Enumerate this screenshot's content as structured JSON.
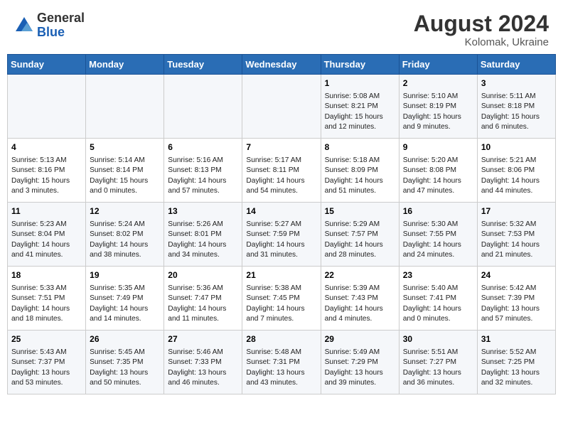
{
  "header": {
    "logo_general": "General",
    "logo_blue": "Blue",
    "month_year": "August 2024",
    "location": "Kolomak, Ukraine"
  },
  "days_of_week": [
    "Sunday",
    "Monday",
    "Tuesday",
    "Wednesday",
    "Thursday",
    "Friday",
    "Saturday"
  ],
  "weeks": [
    [
      {
        "day": "",
        "info": ""
      },
      {
        "day": "",
        "info": ""
      },
      {
        "day": "",
        "info": ""
      },
      {
        "day": "",
        "info": ""
      },
      {
        "day": "1",
        "info": "Sunrise: 5:08 AM\nSunset: 8:21 PM\nDaylight: 15 hours\nand 12 minutes."
      },
      {
        "day": "2",
        "info": "Sunrise: 5:10 AM\nSunset: 8:19 PM\nDaylight: 15 hours\nand 9 minutes."
      },
      {
        "day": "3",
        "info": "Sunrise: 5:11 AM\nSunset: 8:18 PM\nDaylight: 15 hours\nand 6 minutes."
      }
    ],
    [
      {
        "day": "4",
        "info": "Sunrise: 5:13 AM\nSunset: 8:16 PM\nDaylight: 15 hours\nand 3 minutes."
      },
      {
        "day": "5",
        "info": "Sunrise: 5:14 AM\nSunset: 8:14 PM\nDaylight: 15 hours\nand 0 minutes."
      },
      {
        "day": "6",
        "info": "Sunrise: 5:16 AM\nSunset: 8:13 PM\nDaylight: 14 hours\nand 57 minutes."
      },
      {
        "day": "7",
        "info": "Sunrise: 5:17 AM\nSunset: 8:11 PM\nDaylight: 14 hours\nand 54 minutes."
      },
      {
        "day": "8",
        "info": "Sunrise: 5:18 AM\nSunset: 8:09 PM\nDaylight: 14 hours\nand 51 minutes."
      },
      {
        "day": "9",
        "info": "Sunrise: 5:20 AM\nSunset: 8:08 PM\nDaylight: 14 hours\nand 47 minutes."
      },
      {
        "day": "10",
        "info": "Sunrise: 5:21 AM\nSunset: 8:06 PM\nDaylight: 14 hours\nand 44 minutes."
      }
    ],
    [
      {
        "day": "11",
        "info": "Sunrise: 5:23 AM\nSunset: 8:04 PM\nDaylight: 14 hours\nand 41 minutes."
      },
      {
        "day": "12",
        "info": "Sunrise: 5:24 AM\nSunset: 8:02 PM\nDaylight: 14 hours\nand 38 minutes."
      },
      {
        "day": "13",
        "info": "Sunrise: 5:26 AM\nSunset: 8:01 PM\nDaylight: 14 hours\nand 34 minutes."
      },
      {
        "day": "14",
        "info": "Sunrise: 5:27 AM\nSunset: 7:59 PM\nDaylight: 14 hours\nand 31 minutes."
      },
      {
        "day": "15",
        "info": "Sunrise: 5:29 AM\nSunset: 7:57 PM\nDaylight: 14 hours\nand 28 minutes."
      },
      {
        "day": "16",
        "info": "Sunrise: 5:30 AM\nSunset: 7:55 PM\nDaylight: 14 hours\nand 24 minutes."
      },
      {
        "day": "17",
        "info": "Sunrise: 5:32 AM\nSunset: 7:53 PM\nDaylight: 14 hours\nand 21 minutes."
      }
    ],
    [
      {
        "day": "18",
        "info": "Sunrise: 5:33 AM\nSunset: 7:51 PM\nDaylight: 14 hours\nand 18 minutes."
      },
      {
        "day": "19",
        "info": "Sunrise: 5:35 AM\nSunset: 7:49 PM\nDaylight: 14 hours\nand 14 minutes."
      },
      {
        "day": "20",
        "info": "Sunrise: 5:36 AM\nSunset: 7:47 PM\nDaylight: 14 hours\nand 11 minutes."
      },
      {
        "day": "21",
        "info": "Sunrise: 5:38 AM\nSunset: 7:45 PM\nDaylight: 14 hours\nand 7 minutes."
      },
      {
        "day": "22",
        "info": "Sunrise: 5:39 AM\nSunset: 7:43 PM\nDaylight: 14 hours\nand 4 minutes."
      },
      {
        "day": "23",
        "info": "Sunrise: 5:40 AM\nSunset: 7:41 PM\nDaylight: 14 hours\nand 0 minutes."
      },
      {
        "day": "24",
        "info": "Sunrise: 5:42 AM\nSunset: 7:39 PM\nDaylight: 13 hours\nand 57 minutes."
      }
    ],
    [
      {
        "day": "25",
        "info": "Sunrise: 5:43 AM\nSunset: 7:37 PM\nDaylight: 13 hours\nand 53 minutes."
      },
      {
        "day": "26",
        "info": "Sunrise: 5:45 AM\nSunset: 7:35 PM\nDaylight: 13 hours\nand 50 minutes."
      },
      {
        "day": "27",
        "info": "Sunrise: 5:46 AM\nSunset: 7:33 PM\nDaylight: 13 hours\nand 46 minutes."
      },
      {
        "day": "28",
        "info": "Sunrise: 5:48 AM\nSunset: 7:31 PM\nDaylight: 13 hours\nand 43 minutes."
      },
      {
        "day": "29",
        "info": "Sunrise: 5:49 AM\nSunset: 7:29 PM\nDaylight: 13 hours\nand 39 minutes."
      },
      {
        "day": "30",
        "info": "Sunrise: 5:51 AM\nSunset: 7:27 PM\nDaylight: 13 hours\nand 36 minutes."
      },
      {
        "day": "31",
        "info": "Sunrise: 5:52 AM\nSunset: 7:25 PM\nDaylight: 13 hours\nand 32 minutes."
      }
    ]
  ]
}
